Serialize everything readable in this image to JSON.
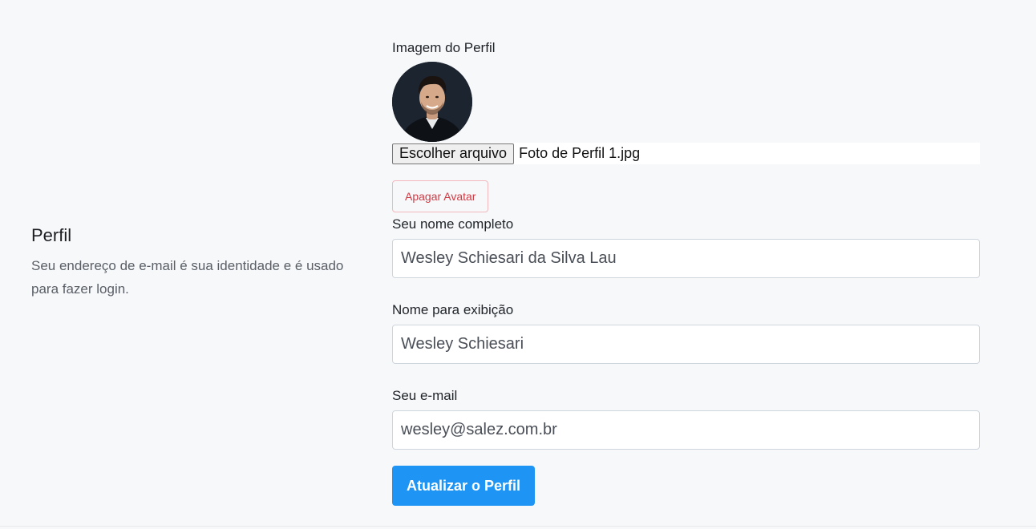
{
  "section": {
    "title": "Perfil",
    "description": "Seu endereço de e-mail é sua identidade e é usado para fazer login."
  },
  "avatar": {
    "label": "Imagem do Perfil",
    "file_button": "Escolher arquivo",
    "file_name": "Foto de Perfil 1.jpg",
    "delete_label": "Apagar Avatar"
  },
  "fields": {
    "full_name": {
      "label": "Seu nome completo",
      "value": "Wesley Schiesari da Silva Lau"
    },
    "display_name": {
      "label": "Nome para exibição",
      "value": "Wesley Schiesari"
    },
    "email": {
      "label": "Seu e-mail",
      "value": "wesley@salez.com.br"
    }
  },
  "submit_label": "Atualizar o Perfil",
  "colors": {
    "background": "#f7f8fa",
    "primary": "#1e95f5",
    "danger": "#d03a44",
    "input_border": "#cfd5dd"
  }
}
